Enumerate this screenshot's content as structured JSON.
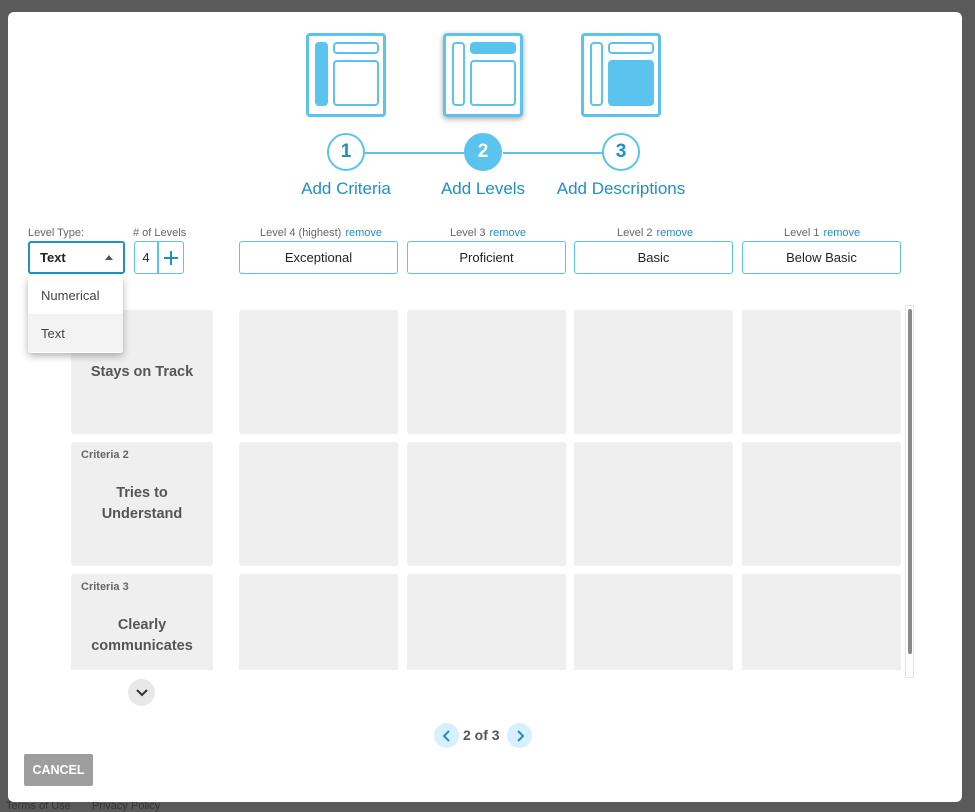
{
  "footer": {
    "terms": "Terms of Use",
    "privacy": "Privacy Policy"
  },
  "steps": [
    {
      "number": "1",
      "label": "Add Criteria"
    },
    {
      "number": "2",
      "label": "Add Levels"
    },
    {
      "number": "3",
      "label": "Add Descriptions"
    }
  ],
  "level_type": {
    "label": "Level Type:",
    "value": "Text",
    "options": [
      "Numerical",
      "Text"
    ]
  },
  "num_levels": {
    "label": "# of Levels",
    "value": "4",
    "add_icon": "plus-icon"
  },
  "levels": [
    {
      "header": "Level 4 (highest)",
      "remove": "remove",
      "value": "Exceptional"
    },
    {
      "header": "Level 3",
      "remove": "remove",
      "value": "Proficient"
    },
    {
      "header": "Level 2",
      "remove": "remove",
      "value": "Basic"
    },
    {
      "header": "Level 1",
      "remove": "remove",
      "value": "Below Basic"
    }
  ],
  "criteria": [
    {
      "tag": "",
      "name": "Stays on Track"
    },
    {
      "tag": "Criteria 2",
      "name": "Tries to Understand"
    },
    {
      "tag": "Criteria 3",
      "name": "Clearly communicates"
    }
  ],
  "pagination": {
    "text": "2 of 3"
  },
  "cancel_label": "CANCEL",
  "colors": {
    "accent": "#5ac3ee",
    "text_accent": "#1f8fc8",
    "cell": "#efefef"
  }
}
